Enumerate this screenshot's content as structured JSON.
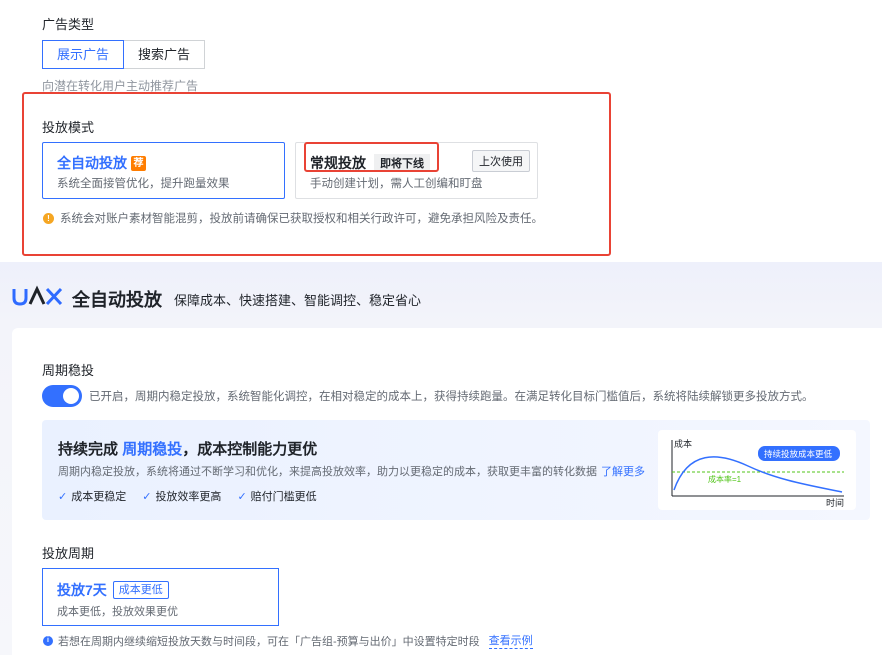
{
  "ad_type": {
    "label": "广告类型",
    "options": [
      "展示广告",
      "搜索广告"
    ],
    "selected": "展示广告",
    "hint": "向潜在转化用户主动推荐广告"
  },
  "delivery_mode": {
    "label": "投放模式",
    "auto": {
      "title": "全自动投放",
      "badge": "荐",
      "desc": "系统全面接管优化，提升跑量效果"
    },
    "regular": {
      "title": "常规投放",
      "badge": "即将下线",
      "desc": "手动创建计划，需人工创编和盯盘",
      "last_used": "上次使用"
    },
    "warning": "系统会对账户素材智能混剪，投放前请确保已获取授权和相关行政许可，避免承担风险及责任。"
  },
  "uax": {
    "logo": "UAX",
    "title": "全自动投放",
    "subtitle": "保障成本、快速搭建、智能调控、稳定省心"
  },
  "period_stable": {
    "label": "周期稳投",
    "toggle_on": true,
    "toggle_text": "已开启，周期内稳定投放，系统智能化调控，在相对稳定的成本上，获得持续跑量。在满足转化目标门槛值后，系统将陆续解锁更多投放方式。"
  },
  "promo": {
    "title_prefix": "持续完成",
    "title_highlight": "周期稳投",
    "title_suffix": "，成本控制能力更优",
    "desc": "周期内稳定投放，系统将通过不断学习和优化，来提高投放效率，助力以更稳定的成本，获取更丰富的转化数据",
    "learn_more": "了解更多",
    "checks": [
      "成本更稳定",
      "投放效率更高",
      "赔付门槛更低"
    ],
    "chart": {
      "y_label": "成本",
      "x_label": "时间",
      "callout": "持续投放成本更低",
      "baseline_label": "成本率=1"
    }
  },
  "period": {
    "label": "投放周期",
    "card_title": "投放7天",
    "card_badge": "成本更低",
    "card_desc": "成本更低，投放效果更优",
    "info": "若想在周期内继续缩短投放天数与时间段，可在「广告组-预算与出价」中设置特定时段",
    "info_link": "查看示例"
  },
  "colors": {
    "primary": "#3370ff",
    "highlight_border": "#e94335",
    "recommend_badge": "#ff7d00",
    "warning": "#f5a623"
  }
}
